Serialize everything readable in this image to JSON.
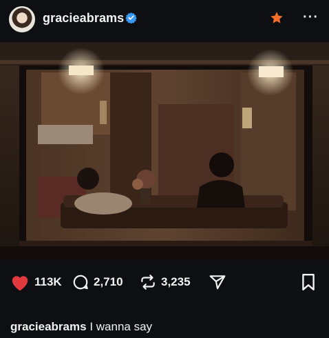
{
  "post": {
    "username": "gracieabrams",
    "caption_user": "gracieabrams",
    "caption_text": "I wanna say"
  },
  "icons": {
    "verified": "verified-badge-icon",
    "star": "star-icon",
    "more": "more-options-icon",
    "like": "heart-icon",
    "comment": "comment-bubble-icon",
    "repost": "repost-arrows-icon",
    "share": "send-paper-plane-icon",
    "save": "bookmark-icon"
  },
  "more_label": "···",
  "stats": {
    "likes": "113K",
    "comments": "2,710",
    "reposts": "3,235"
  },
  "colors": {
    "background": "#0d0f12",
    "like": "#e0393e",
    "verified": "#3897f0",
    "star": "#f36e2b"
  }
}
